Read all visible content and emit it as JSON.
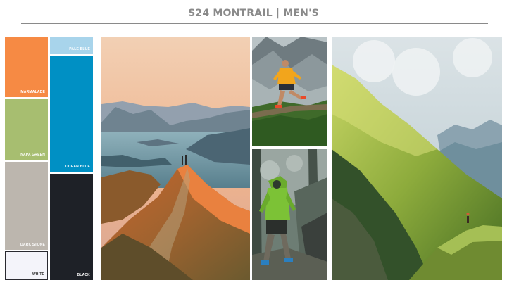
{
  "header": {
    "title": "S24 MONTRAIL | MEN'S"
  },
  "swatches": {
    "marmalade": {
      "label": "MARMALADE",
      "color": "#F68A44"
    },
    "napa_green": {
      "label": "NAPA GREEN",
      "color": "#A7BE70"
    },
    "dark_stone": {
      "label": "DARK STONE",
      "color": "#BCB6AE"
    },
    "white": {
      "label": "WHITE",
      "color": "#F4F4FA"
    },
    "pale_blue": {
      "label": "PALE BLUE",
      "color": "#A8D4EB"
    },
    "ocean_blue": {
      "label": "OCEAN BLUE",
      "color": "#0090C4"
    },
    "black": {
      "label": "BLACK",
      "color": "#1E2127"
    }
  },
  "photos": [
    {
      "subject": "mountain-ridge-lake-sunset-photo"
    },
    {
      "subject": "trail-runner-orange-jacket-photo"
    },
    {
      "subject": "trail-runner-green-jacket-forest-photo"
    },
    {
      "subject": "green-alpine-ridge-hiker-photo"
    }
  ]
}
